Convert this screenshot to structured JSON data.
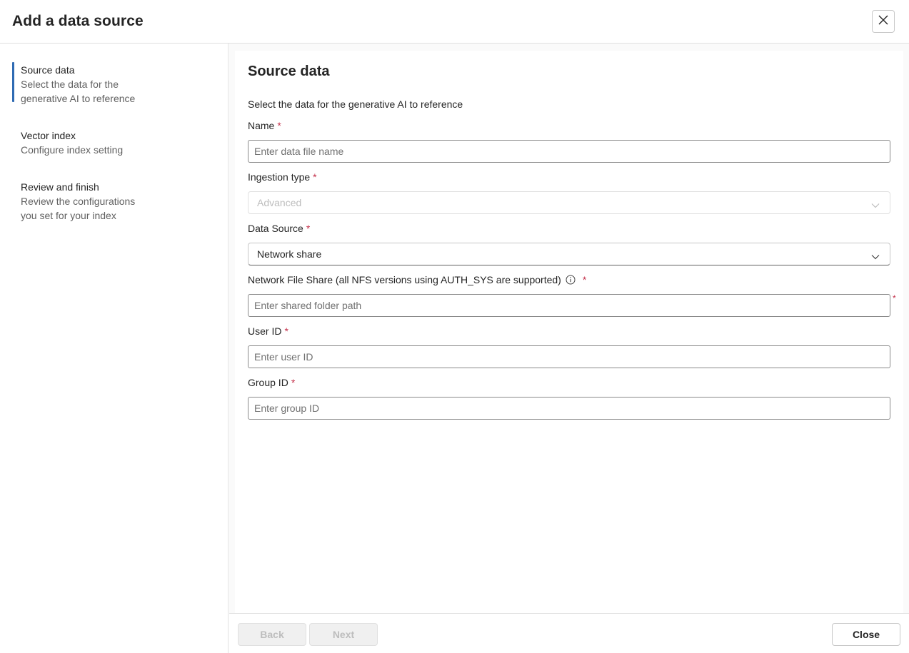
{
  "dialog": {
    "title": "Add a data source",
    "close_icon": "close-icon"
  },
  "steps": [
    {
      "title": "Source data",
      "desc_line1": "Select the data for the",
      "desc_line2": "generative AI to reference",
      "active": true
    },
    {
      "title": "Vector index",
      "desc_line1": "Configure index setting",
      "desc_line2": "",
      "active": false
    },
    {
      "title": "Review and finish",
      "desc_line1": "Review the configurations",
      "desc_line2": "you set for your index",
      "active": false
    }
  ],
  "form": {
    "title": "Source data",
    "description": "Select the data for the generative AI to reference",
    "required_mark": "*",
    "name": {
      "label": "Name",
      "placeholder": "Enter data file name",
      "value": ""
    },
    "ingestion_type": {
      "label": "Ingestion type",
      "value": "Advanced",
      "disabled": true
    },
    "data_source": {
      "label": "Data Source",
      "value": "Network share"
    },
    "network_share": {
      "label": "Network File Share (all NFS versions using AUTH_SYS are supported)",
      "placeholder": "Enter shared folder path",
      "value": "",
      "info_icon": "info-icon"
    },
    "user_id": {
      "label": "User ID",
      "placeholder": "Enter user ID",
      "value": ""
    },
    "group_id": {
      "label": "Group ID",
      "placeholder": "Enter group ID",
      "value": ""
    }
  },
  "footer": {
    "back_label": "Back",
    "next_label": "Next",
    "close_label": "Close"
  },
  "colors": {
    "accent": "#2f6bb3",
    "required": "#c4314b",
    "border": "#e0e0e0"
  }
}
